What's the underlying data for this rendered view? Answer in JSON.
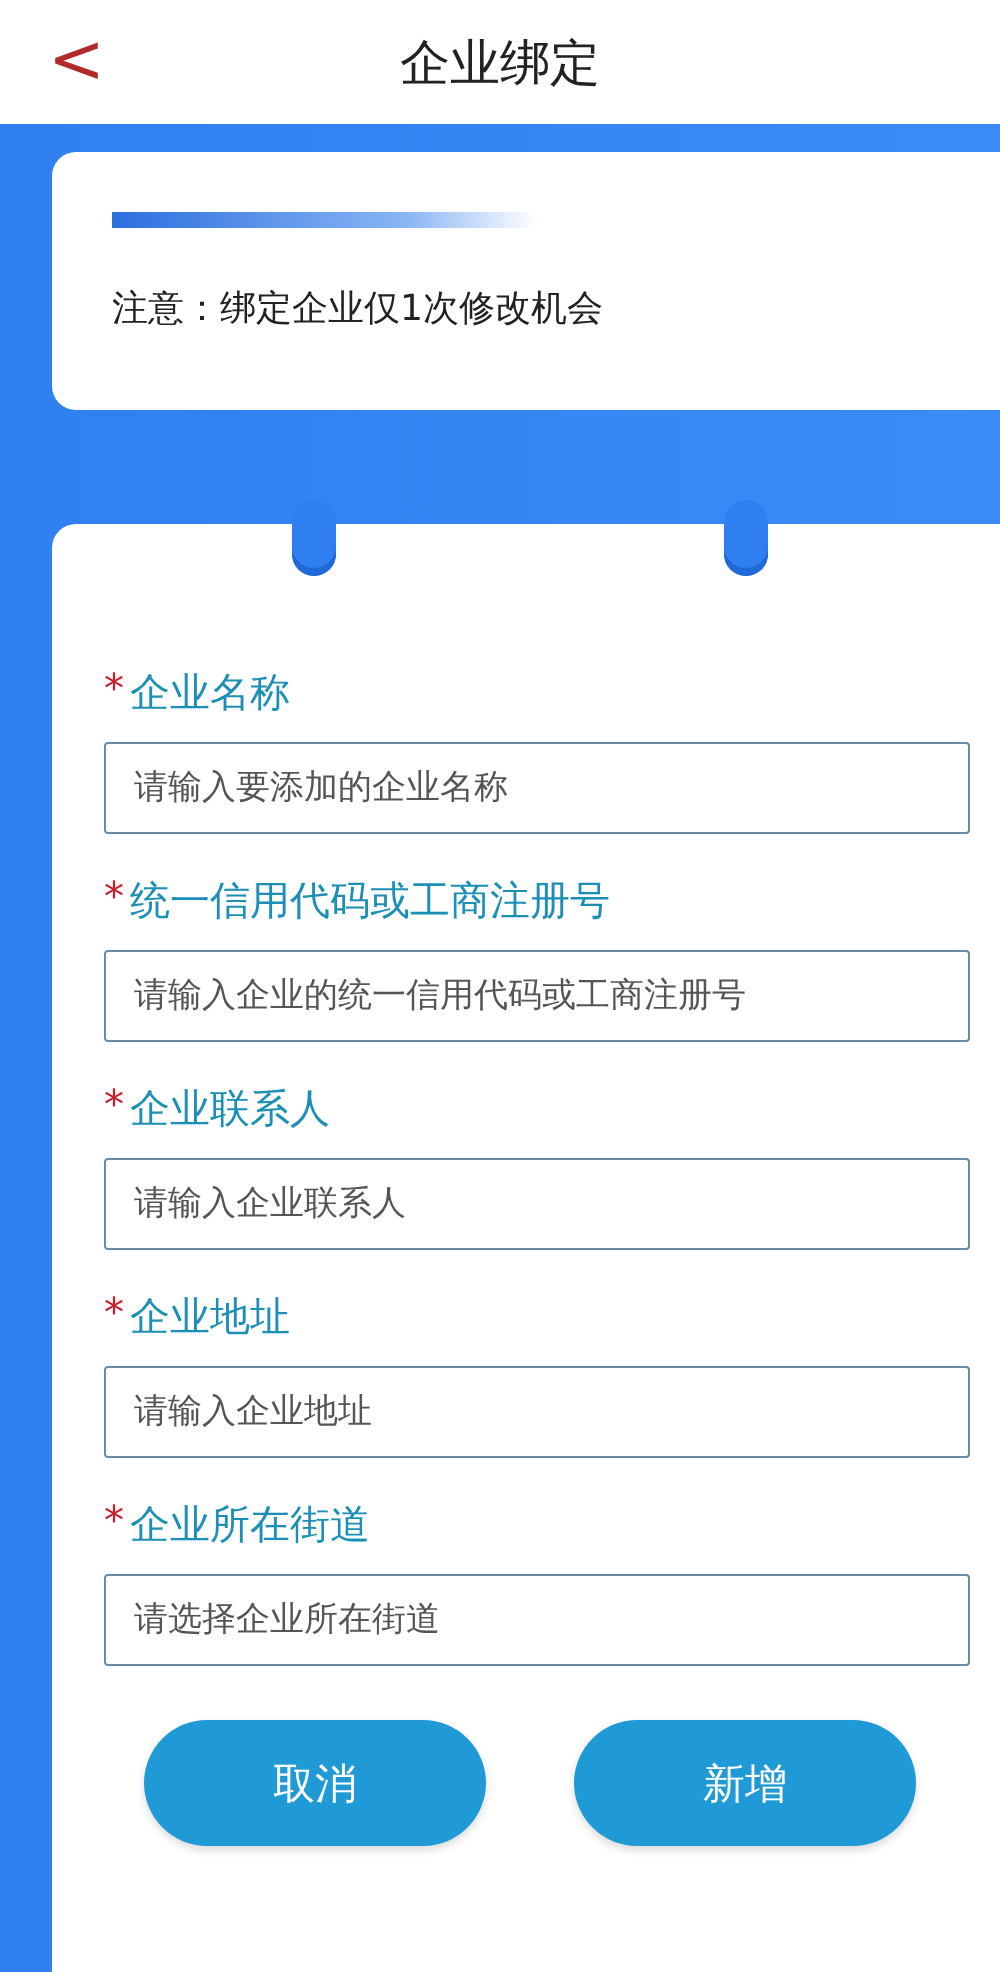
{
  "header": {
    "back": "<",
    "title": "企业绑定"
  },
  "notice": {
    "text": "注意：绑定企业仅1次修改机会"
  },
  "fields": [
    {
      "mark": "*",
      "label": "企业名称",
      "placeholder": "请输入要添加的企业名称"
    },
    {
      "mark": "*",
      "label": "统一信用代码或工商注册号",
      "placeholder": "请输入企业的统一信用代码或工商注册号"
    },
    {
      "mark": "*",
      "label": "企业联系人",
      "placeholder": "请输入企业联系人"
    },
    {
      "mark": "*",
      "label": "企业地址",
      "placeholder": "请输入企业地址"
    },
    {
      "mark": "*",
      "label": "企业所在街道",
      "placeholder": "请选择企业所在街道"
    }
  ],
  "buttons": [
    "取消",
    "新增"
  ]
}
